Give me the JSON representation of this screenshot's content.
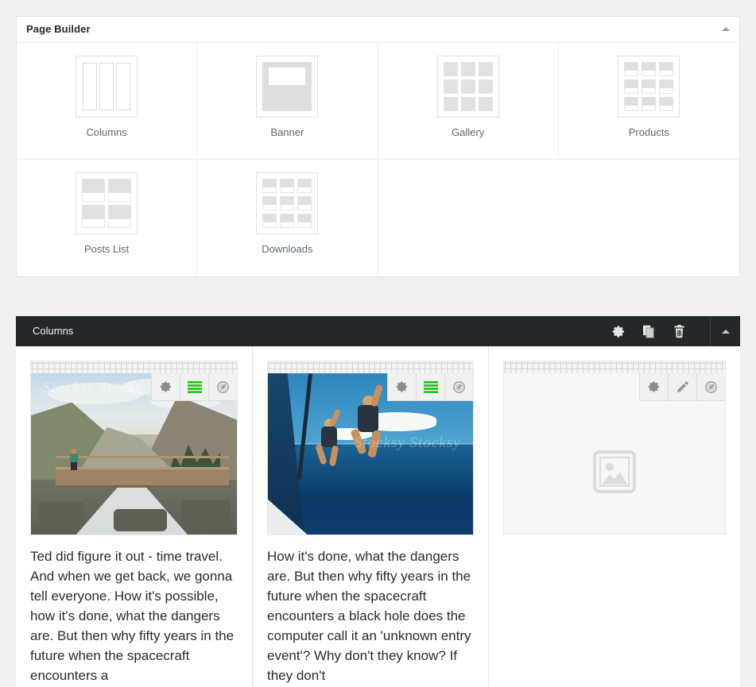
{
  "panel": {
    "title": "Page Builder",
    "collapse_icon": "triangle-up-icon",
    "modules": [
      {
        "label": "Columns",
        "icon": "columns-icon"
      },
      {
        "label": "Banner",
        "icon": "banner-icon"
      },
      {
        "label": "Gallery",
        "icon": "gallery-grid-icon"
      },
      {
        "label": "Products",
        "icon": "products-grid-icon"
      },
      {
        "label": "Posts List",
        "icon": "posts-list-icon"
      },
      {
        "label": "Downloads",
        "icon": "downloads-grid-icon"
      }
    ]
  },
  "row": {
    "title": "Columns",
    "actions": [
      {
        "name": "settings",
        "icon": "gear-icon"
      },
      {
        "name": "duplicate",
        "icon": "copy-icon"
      },
      {
        "name": "delete",
        "icon": "trash-icon"
      }
    ],
    "collapse_icon": "triangle-up-icon",
    "background": "#23282b"
  },
  "columns": [
    {
      "media": {
        "type": "photo",
        "alt": "Hiker crossing a wooden bridge over a mountain stream",
        "watermark": "Stocksy Stocksy Stocksy"
      },
      "toolbar": [
        {
          "name": "settings",
          "icon": "gear-icon",
          "color": "#8c8c8c"
        },
        {
          "name": "lines",
          "icon": "lines-icon",
          "color": "#16c60c"
        },
        {
          "name": "gauge",
          "icon": "gauge-icon",
          "color": "#a0a0a0"
        }
      ],
      "text": "Ted did figure it out - time travel. And when we get back, we gonna tell everyone. How it's possible, how it's done, what the dangers are. But then why fifty years in the future when the spacecraft encounters a"
    },
    {
      "media": {
        "type": "photo",
        "alt": "Two surfers jumping off a boat into the ocean with surfboards",
        "watermark": "Stocksy Stocksy"
      },
      "toolbar": [
        {
          "name": "settings",
          "icon": "gear-icon",
          "color": "#8c8c8c"
        },
        {
          "name": "lines",
          "icon": "lines-icon",
          "color": "#16c60c"
        },
        {
          "name": "gauge",
          "icon": "gauge-icon",
          "color": "#a0a0a0"
        }
      ],
      "text": "How it's done, what the dangers are. But then why fifty years in the future when the spacecraft encounters a black hole does the computer call it an 'unknown entry event'? Why don't they know? If they don't"
    },
    {
      "media": {
        "type": "placeholder",
        "alt": "Empty image placeholder",
        "icon": "image-placeholder-icon"
      },
      "toolbar": [
        {
          "name": "settings",
          "icon": "gear-icon",
          "color": "#8c8c8c"
        },
        {
          "name": "edit",
          "icon": "pencil-icon",
          "color": "#8c8c8c"
        },
        {
          "name": "gauge",
          "icon": "gauge-icon",
          "color": "#a0a0a0"
        }
      ],
      "text": ""
    }
  ]
}
